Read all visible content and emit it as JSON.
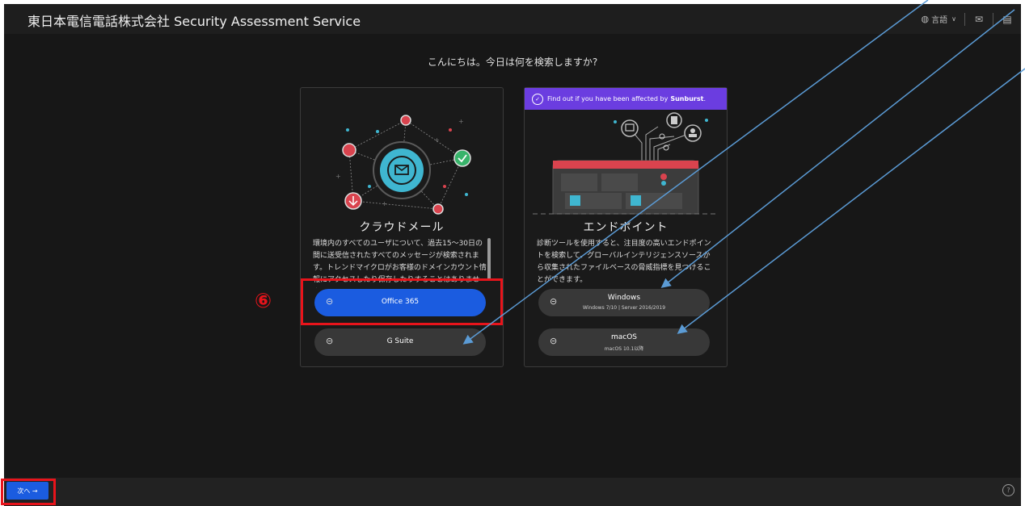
{
  "header": {
    "title": "東日本電信電話株式会社 Security Assessment Service",
    "language_label": "言語",
    "icons": [
      "globe-icon",
      "mail-icon",
      "document-icon"
    ]
  },
  "greeting": "こんにちは。今日は何を検索しますか?",
  "cloud_mail": {
    "title": "クラウドメール",
    "description": "環境内のすべてのユーザについて、過去15～30日の間に送受信されたすべてのメッセージが検索されます。トレンドマイクロがお客様のドメインカウント情報にアクセスしたり保存したりすることはありません。",
    "options": [
      {
        "label": "Office 365",
        "icon": "sign-in-icon",
        "selected": true
      },
      {
        "label": "G Suite",
        "icon": "sign-in-icon",
        "selected": false
      }
    ]
  },
  "endpoint": {
    "banner_text": "Find out if you have been affected by",
    "banner_highlight": "Sunburst",
    "banner_end": ".",
    "title": "エンドポイント",
    "description": "診断ツールを使用すると、注目度の高いエンドポイントを検索して、グローバルインテリジェンスソースから収集されたファイルベースの脅威指標を見つけることができます。",
    "options": [
      {
        "label": "Windows",
        "sub": "Windows 7/10 | Server 2016/2019",
        "icon": "sign-in-icon"
      },
      {
        "label": "macOS",
        "sub": "macOS 10.1以降",
        "icon": "sign-in-icon"
      }
    ]
  },
  "footer": {
    "next_label": "次へ →",
    "help_icon": "question-circle-icon"
  },
  "annotation": {
    "step_marker": "⑥",
    "highlight_color": "#e8141b",
    "arrow_color": "#5b9bd5"
  },
  "colors": {
    "accent_blue": "#1b5ce0",
    "banner_purple": "#6b3de0",
    "background": "#171717"
  }
}
